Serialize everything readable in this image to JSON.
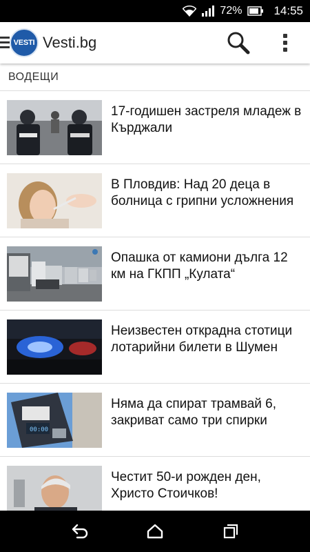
{
  "status_bar": {
    "battery_percent": "72%",
    "time": "14:55",
    "icons": [
      "wifi-icon",
      "signal-icon",
      "battery-icon"
    ]
  },
  "app_bar": {
    "logo_text": "VESTI",
    "title": "Vesti.bg",
    "icons": [
      "menu-icon",
      "search-icon",
      "more-vert-icon"
    ]
  },
  "section": {
    "title": "ВОДЕЩИ"
  },
  "news": [
    {
      "title": "17-годишен застреля младеж в Кърджали",
      "image": "police-photo"
    },
    {
      "title": "В Пловдив: Над 20 деца в болница с грипни усложнения",
      "image": "sick-child-photo"
    },
    {
      "title": "Опашка от камиони дълга 12 км на ГКПП „Кулата“",
      "image": "trucks-photo"
    },
    {
      "title": "Неизвестен открадна стотици лотарийни билети в Шумен",
      "image": "police-light-photo"
    },
    {
      "title": "Няма да спират трамвай 6, закриват само три спирки",
      "image": "ticket-machine-photo"
    },
    {
      "title": "Честит 50-и рожден ден, Христо Стоичков!",
      "image": "portrait-photo"
    }
  ],
  "nav_bar": {
    "icons": [
      "back-icon",
      "home-icon",
      "recents-icon"
    ]
  },
  "colors": {
    "logo_blue": "#1f5aa8",
    "status_bg": "#000000",
    "divider": "#dcdcdc"
  }
}
